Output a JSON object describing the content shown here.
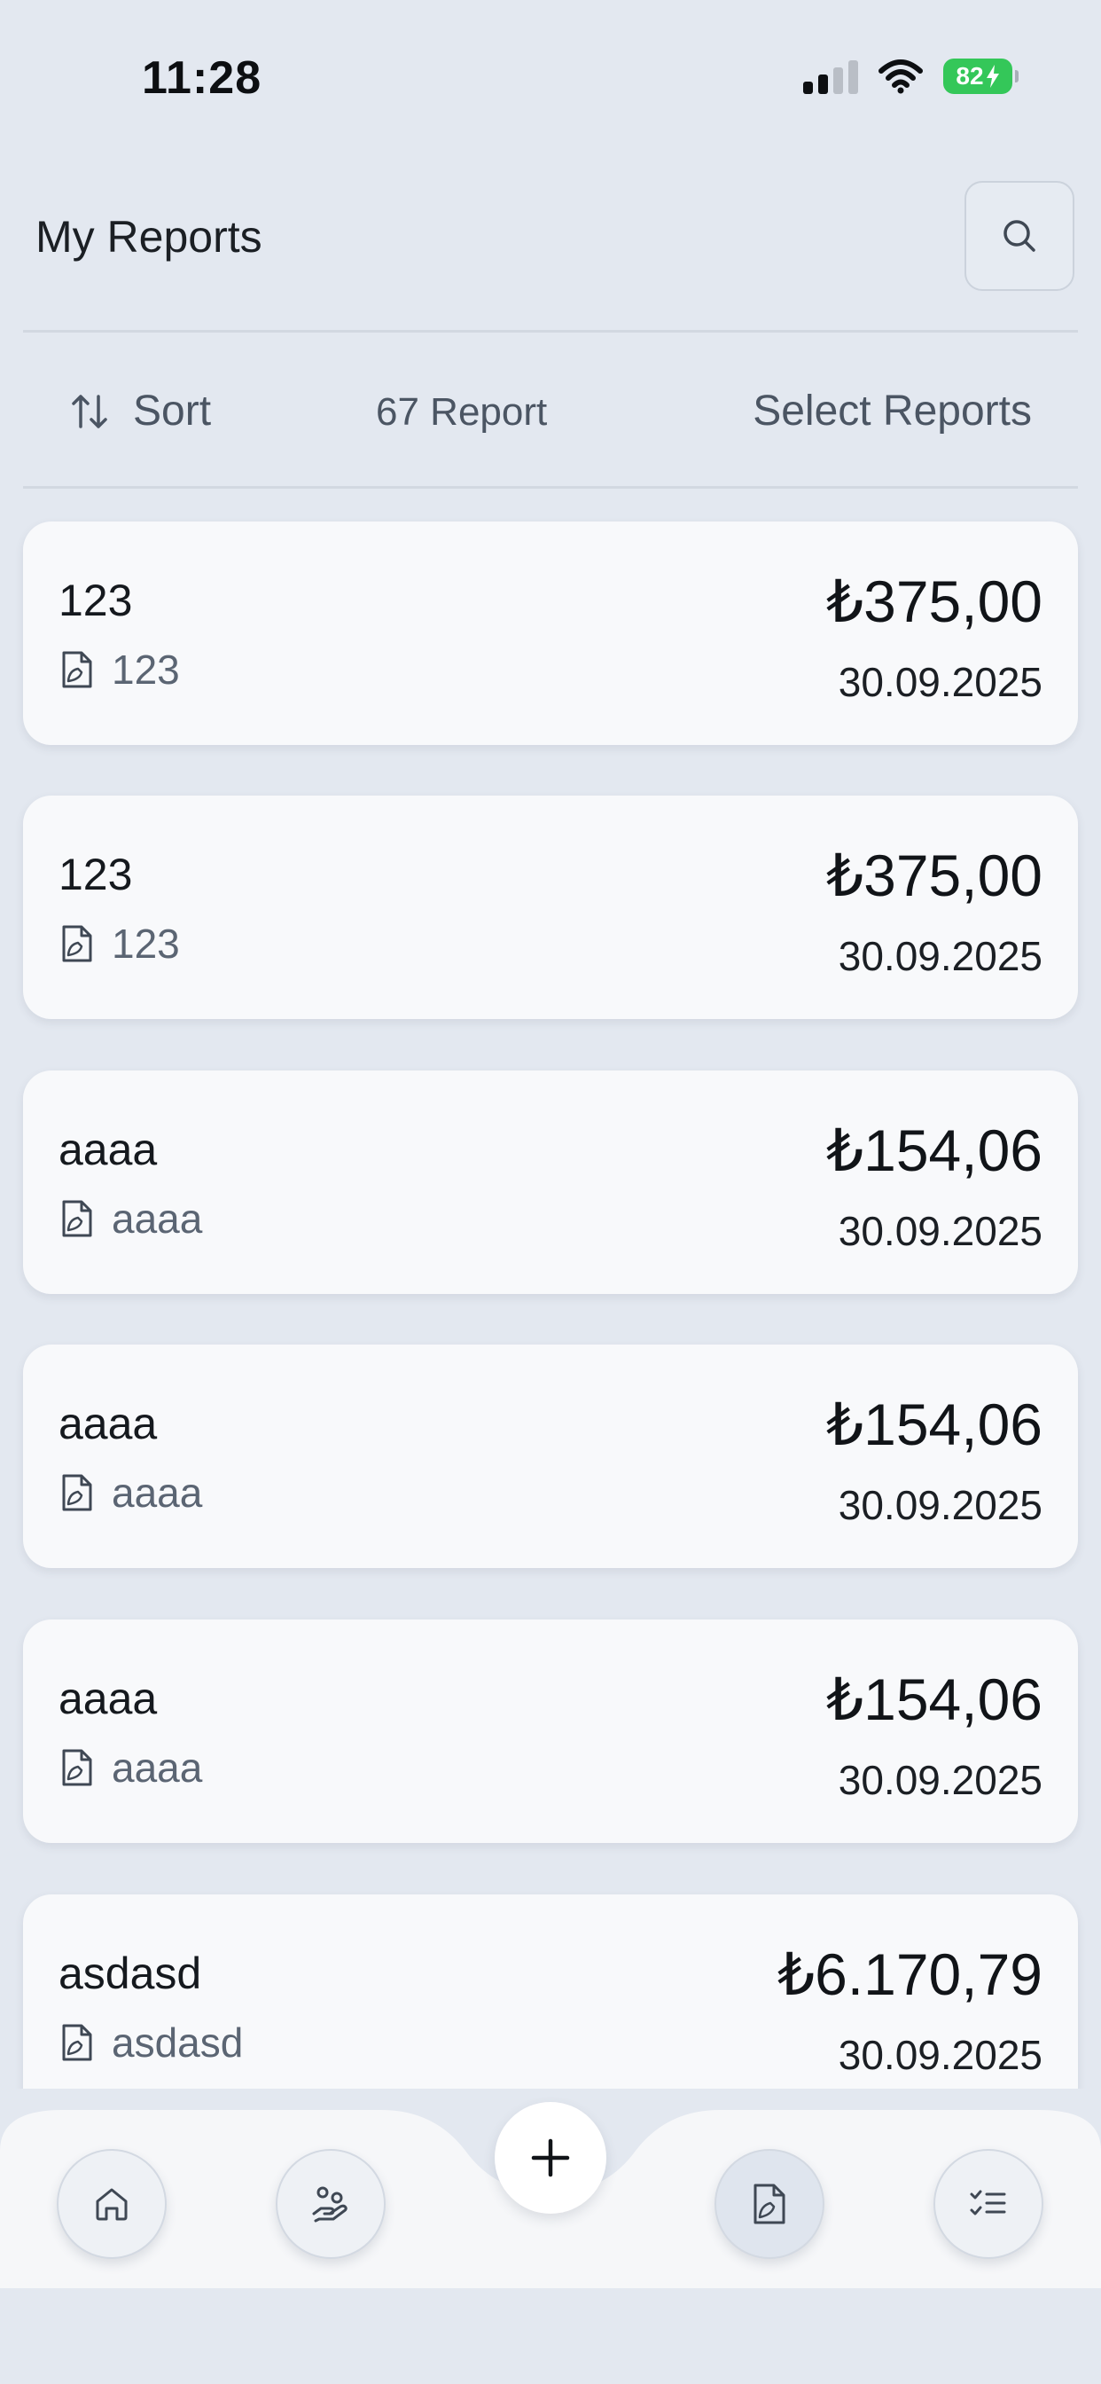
{
  "status_bar": {
    "time": "11:28",
    "battery_percent": "82",
    "battery_charging": true,
    "signal_bars_active": 2,
    "signal_bars_total": 4,
    "icons": [
      "cellular-signal-icon",
      "wifi-icon",
      "battery-charging-icon"
    ]
  },
  "header": {
    "title": "My Reports",
    "search_icon": "search-icon"
  },
  "toolbar": {
    "sort_label": "Sort",
    "sort_icon": "sort-arrows-icon",
    "report_count": "67 Report",
    "select_label": "Select Reports"
  },
  "reports": [
    {
      "title": "123",
      "subtitle": "123",
      "amount": "₺375,00",
      "date": "30.09.2025"
    },
    {
      "title": "123",
      "subtitle": "123",
      "amount": "₺375,00",
      "date": "30.09.2025"
    },
    {
      "title": "aaaa",
      "subtitle": "aaaa",
      "amount": "₺154,06",
      "date": "30.09.2025"
    },
    {
      "title": "aaaa",
      "subtitle": "aaaa",
      "amount": "₺154,06",
      "date": "30.09.2025"
    },
    {
      "title": "aaaa",
      "subtitle": "aaaa",
      "amount": "₺154,06",
      "date": "30.09.2025"
    },
    {
      "title": "asdasd",
      "subtitle": "asdasd",
      "amount": "₺6.170,79",
      "date": "30.09.2025"
    }
  ],
  "report_icon": "report-file-icon",
  "bottom_nav": {
    "items": [
      {
        "name": "home",
        "icon": "home-icon",
        "active": false
      },
      {
        "name": "expenses",
        "icon": "hand-coins-icon",
        "active": false
      },
      {
        "name": "reports",
        "icon": "report-file-icon",
        "active": true
      },
      {
        "name": "tasks",
        "icon": "checklist-icon",
        "active": false
      }
    ],
    "add_icon": "plus-icon"
  },
  "colors": {
    "background": "#e3e8f0",
    "card": "#f8f9fb",
    "muted_text": "#4b5563",
    "battery_green": "#34c759"
  }
}
